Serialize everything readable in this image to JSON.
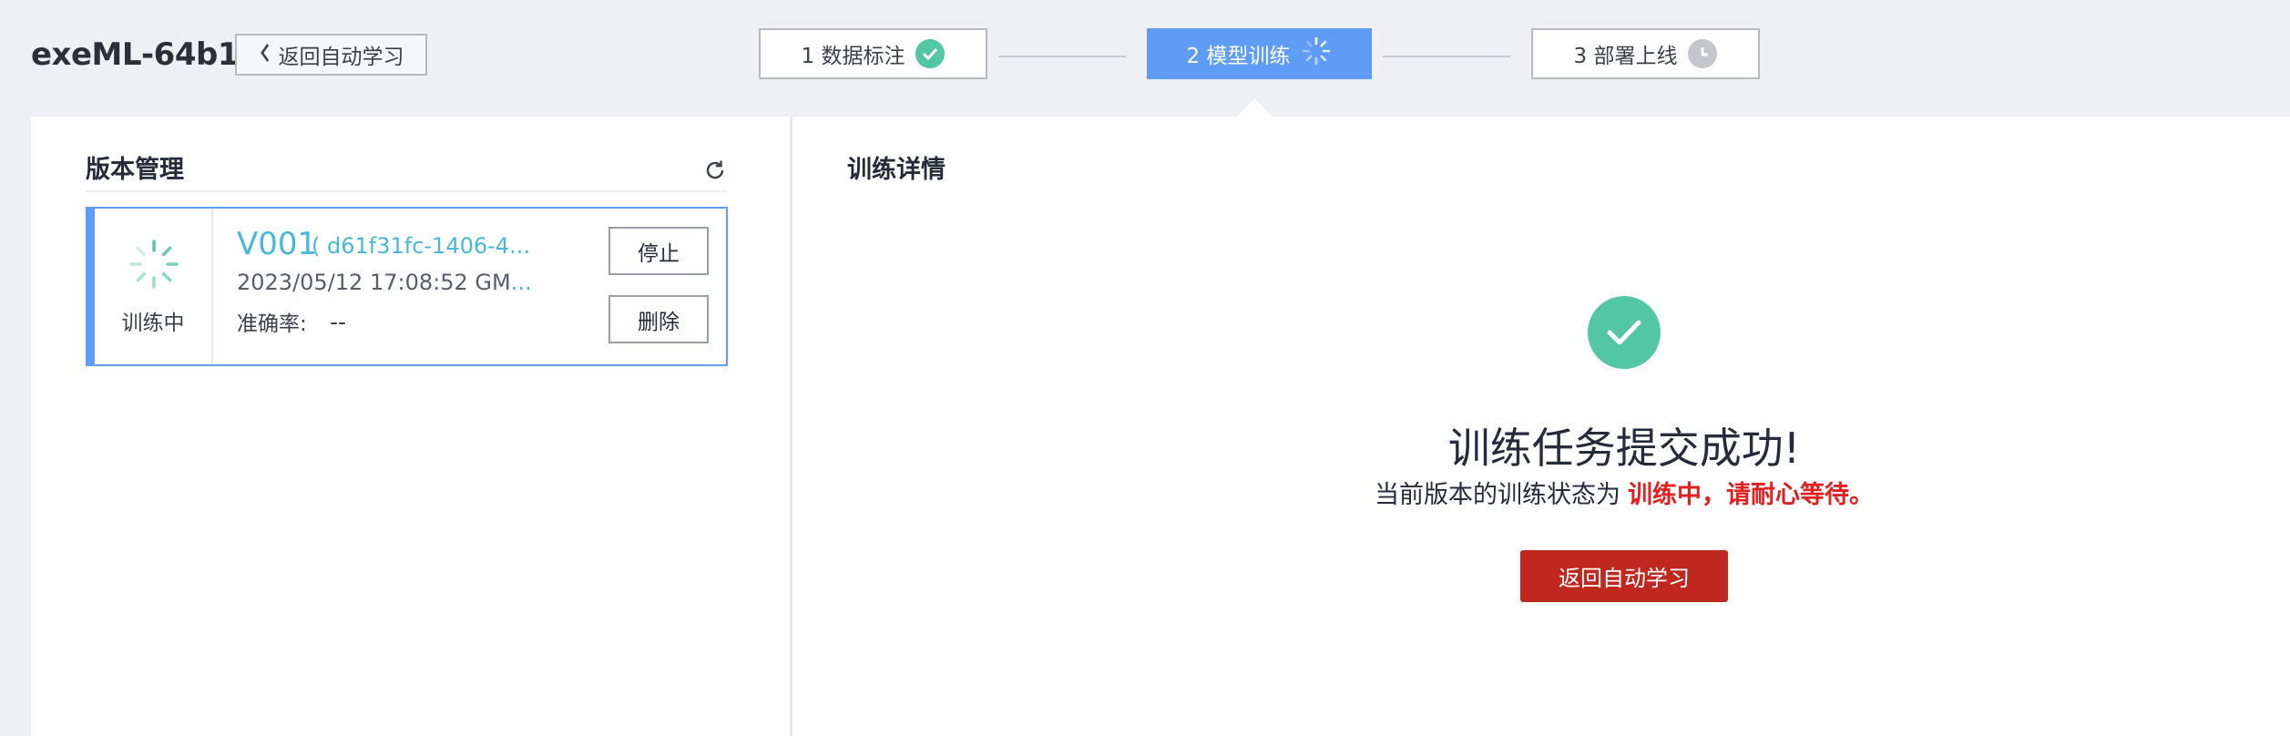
{
  "header": {
    "app_title": "exeML-64b1",
    "back_label": "返回自动学习"
  },
  "steps": [
    {
      "label": "1 数据标注",
      "status": "done",
      "icon": "check-circle-icon"
    },
    {
      "label": "2 模型训练",
      "status": "active",
      "icon": "spinner-icon"
    },
    {
      "label": "3 部署上线",
      "status": "pending",
      "icon": "clock-icon"
    }
  ],
  "version_panel": {
    "title": "版本管理",
    "refresh_icon": "refresh-icon",
    "versions": [
      {
        "status_label": "训练中",
        "name": "V001",
        "id": "( d61f31fc-1406-4...",
        "time": "2023/05/12 17:08:52 GM",
        "time_ellipsis": "...",
        "accuracy_label": "准确率:",
        "accuracy_value": "--",
        "stop_label": "停止",
        "delete_label": "删除"
      }
    ]
  },
  "detail_panel": {
    "title": "训练详情",
    "success_title": "训练任务提交成功!",
    "status_prefix": "当前版本的训练状态为",
    "status_highlight": "训练中，请耐心等待。",
    "back_button": "返回自动学习"
  },
  "colors": {
    "accent_blue": "#5e9cf6",
    "success_green": "#52c7a2",
    "link_cyan": "#48b8d8",
    "alert_red": "#e02020",
    "primary_button": "#c0281f"
  }
}
